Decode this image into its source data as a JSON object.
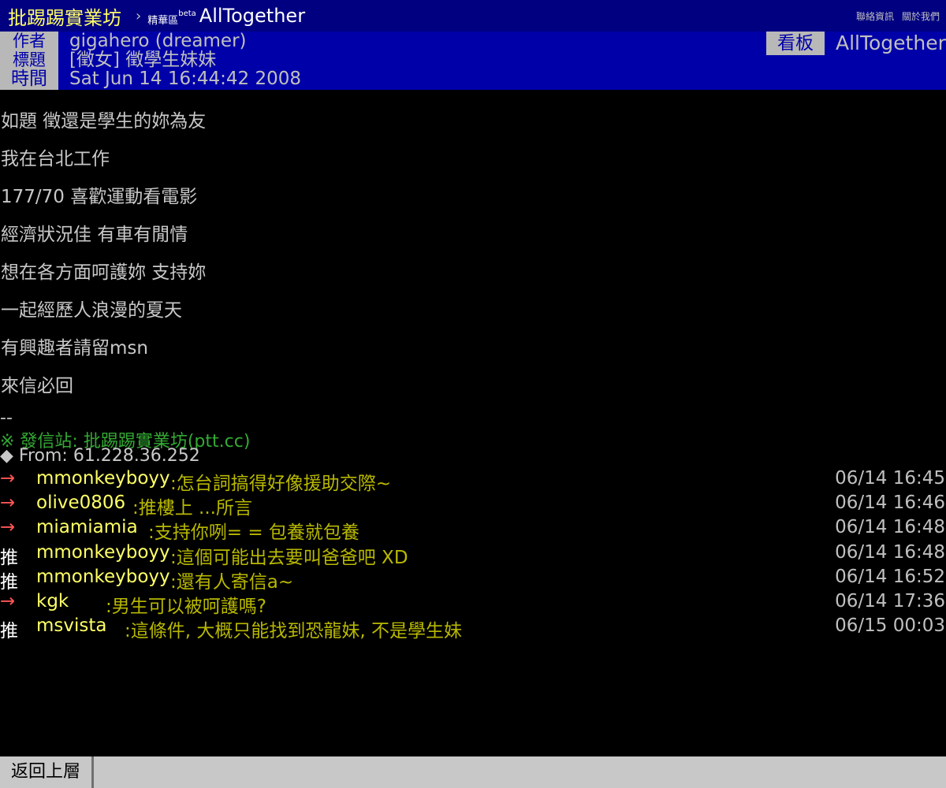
{
  "topbar": {
    "site_title": "批踢踢實業坊",
    "separator": "›",
    "section": "精華區",
    "section_badge": "beta",
    "board": "AllTogether",
    "links": [
      "聯絡資訊",
      "關於我們"
    ]
  },
  "header": {
    "author_label": "作者",
    "author": "gigahero (dreamer)",
    "title_label": "標題",
    "title": "[徵女] 徵學生妹妹",
    "time_label": "時間",
    "time": "Sat Jun 14 16:44:42 2008",
    "board_label": "看板",
    "board": "AllTogether"
  },
  "body": {
    "lines": [
      "如題  徵還是學生的妳為友",
      "我在台北工作",
      "177/70 喜歡運動看電影",
      "經濟狀況佳  有車有閒情",
      "想在各方面呵護妳  支持妳",
      "一起經歷人浪漫的夏天",
      "有興趣者請留msn",
      "來信必回"
    ],
    "dash": "--",
    "signature_site": "※ 發信站: 批踢踢實業坊(ptt.cc)",
    "signature_from": "◆ From: 61.228.36.252"
  },
  "pushes": [
    {
      "tag": "→",
      "kind": "arrow",
      "user": "mmonkeyboyy",
      "text": ":怎台詞搞得好像援助交際~",
      "time": "06/14 16:45"
    },
    {
      "tag": "→",
      "kind": "arrow",
      "user": "olive0806",
      "text": ":推樓上 ...所言",
      "time": "06/14 16:46"
    },
    {
      "tag": "→",
      "kind": "arrow",
      "user": "miamiamia",
      "text": ":支持你咧= = 包養就包養",
      "time": "06/14 16:48"
    },
    {
      "tag": "推",
      "kind": "up",
      "user": "mmonkeyboyy",
      "text": ":這個可能出去要叫爸爸吧  XD",
      "time": "06/14 16:48"
    },
    {
      "tag": "推",
      "kind": "up",
      "user": "mmonkeyboyy",
      "text": ":還有人寄信a~",
      "time": "06/14 16:52"
    },
    {
      "tag": "→",
      "kind": "arrow",
      "user": "kgk",
      "text": ":男生可以被呵護嗎?",
      "time": "06/14 17:36"
    },
    {
      "tag": "推",
      "kind": "up",
      "user": "msvista",
      "text": ":這條件, 大概只能找到恐龍妹, 不是學生妹",
      "time": "06/15 00:03"
    }
  ],
  "bottombar": {
    "back_label": "返回上層"
  }
}
